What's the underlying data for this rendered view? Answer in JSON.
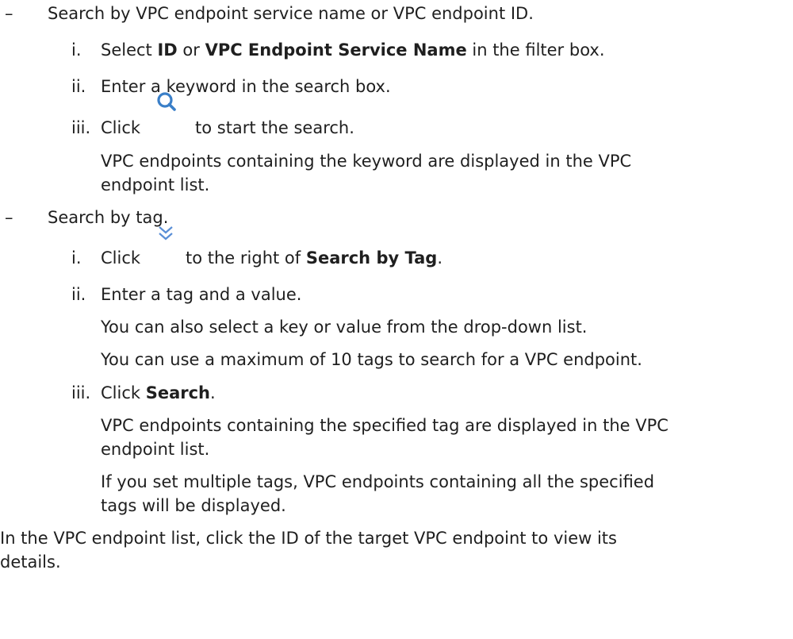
{
  "doc": {
    "b1": {
      "marker": "–",
      "text": "Search by VPC endpoint service name or VPC endpoint ID.",
      "steps": [
        {
          "num": "i.",
          "pre": "Select ",
          "b1": "ID",
          "mid": " or ",
          "b2": "VPC Endpoint Service Name",
          "post": " in the filter box."
        },
        {
          "num": "ii.",
          "text": "Enter a keyword in the search box."
        },
        {
          "num": "iii.",
          "pre": "Click",
          "icon": "search-icon",
          "post": "to start the search.",
          "note_l1": "VPC endpoints containing the keyword are displayed in the VPC",
          "note_l2": "endpoint list."
        }
      ]
    },
    "b2": {
      "marker": "–",
      "text": "Search by tag.",
      "steps": [
        {
          "num": "i.",
          "pre": "Click",
          "icon": "double-chevron-down-icon",
          "post": "to the right of ",
          "bold": "Search by Tag",
          "end": "."
        },
        {
          "num": "ii.",
          "text": "Enter a tag and a value.",
          "note1": "You can also select a key or value from the drop-down list.",
          "note2": "You can use a maximum of 10 tags to search for a VPC endpoint."
        },
        {
          "num": "iii.",
          "pre": "Click ",
          "bold": "Search",
          "end": ".",
          "note1_l1": "VPC endpoints containing the specified tag are displayed in the VPC",
          "note1_l2": "endpoint list.",
          "note2_l1": "If you set multiple tags, VPC endpoints containing all the specified",
          "note2_l2": "tags will be displayed."
        }
      ]
    },
    "final_l1": "In the VPC endpoint list, click the ID of the target VPC endpoint to view its",
    "final_l2": "details.",
    "colors": {
      "text": "#1f1f1f",
      "icon_search": "#3a7fc8",
      "icon_chevron": "#5a8fd6"
    }
  }
}
